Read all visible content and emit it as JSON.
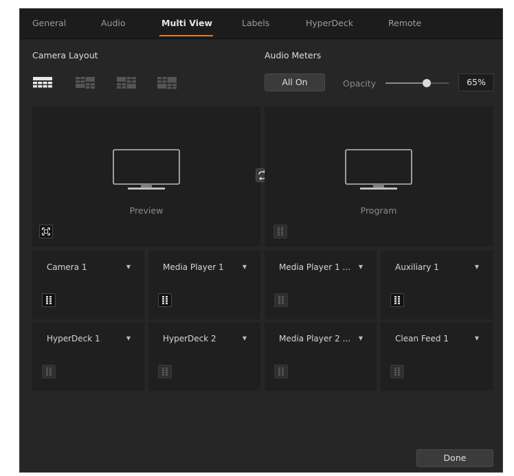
{
  "tabs": [
    {
      "label": "General",
      "active": false
    },
    {
      "label": "Audio",
      "active": false
    },
    {
      "label": "Multi View",
      "active": true
    },
    {
      "label": "Labels",
      "active": false
    },
    {
      "label": "HyperDeck",
      "active": false
    },
    {
      "label": "Remote",
      "active": false
    }
  ],
  "camera_layout": {
    "label": "Camera Layout",
    "selected_index": 0
  },
  "audio_meters": {
    "label": "Audio Meters",
    "toggle_label": "All On",
    "opacity_label": "Opacity",
    "opacity_value": "65%",
    "opacity_level": 0.65
  },
  "preview": {
    "label": "Preview",
    "meter_on": false
  },
  "program": {
    "label": "Program",
    "meter_on": false
  },
  "cells": [
    {
      "source": "Camera 1",
      "meter_on": true
    },
    {
      "source": "Media Player 1",
      "meter_on": true
    },
    {
      "source": "Media Player 1 ...",
      "meter_on": false
    },
    {
      "source": "Auxiliary 1",
      "meter_on": true
    },
    {
      "source": "HyperDeck 1",
      "meter_on": false
    },
    {
      "source": "HyperDeck 2",
      "meter_on": false
    },
    {
      "source": "Media Player 2 ...",
      "meter_on": false
    },
    {
      "source": "Clean Feed 1",
      "meter_on": false
    }
  ],
  "done_label": "Done",
  "colors": {
    "accent": "#e57a20",
    "background": "#262626",
    "panel": "#1f1f1f"
  }
}
